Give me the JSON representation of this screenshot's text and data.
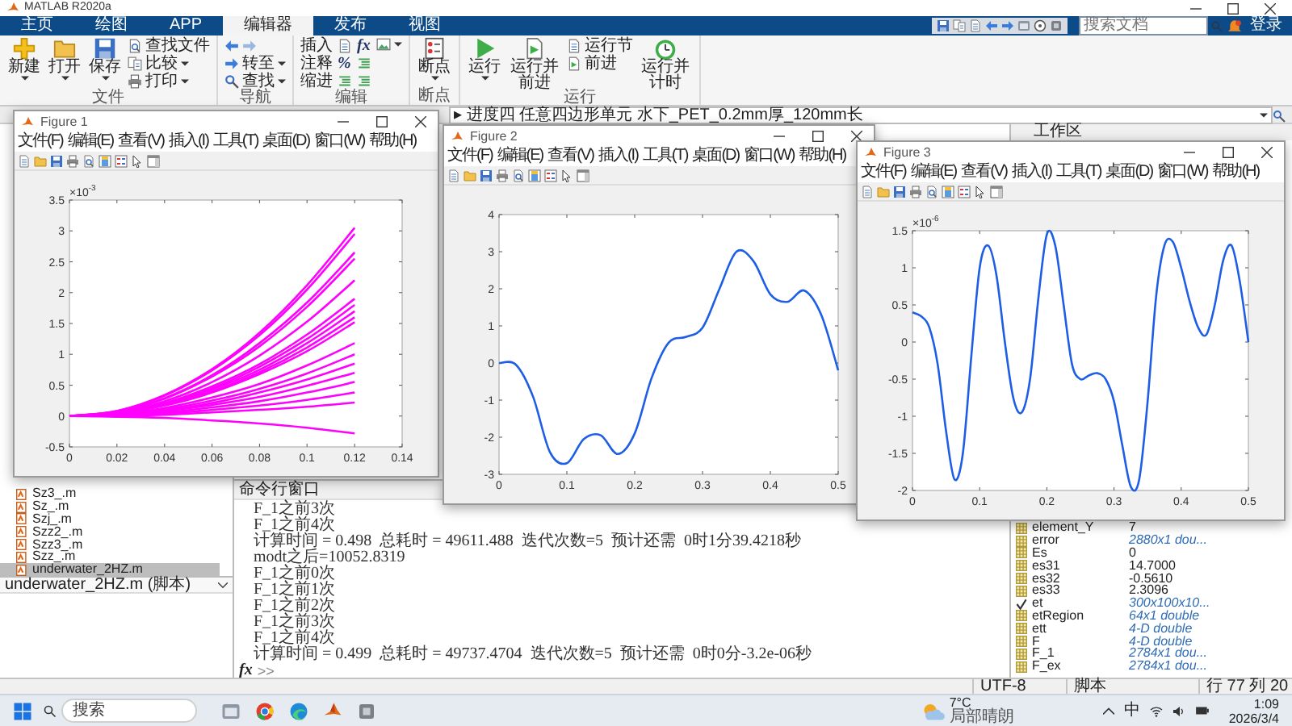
{
  "window": {
    "title": "MATLAB R2020a"
  },
  "tabs": [
    {
      "label": "主页",
      "selected": false
    },
    {
      "label": "绘图",
      "selected": false
    },
    {
      "label": "APP",
      "selected": false
    },
    {
      "label": "编辑器",
      "selected": true
    },
    {
      "label": "发布",
      "selected": false
    },
    {
      "label": "视图",
      "selected": false
    }
  ],
  "search": {
    "placeholder": "搜索文档"
  },
  "sign_in": "登录",
  "ribbon": [
    {
      "label": "文件",
      "columns": [
        [
          [
            {
              "kind": "large",
              "label": "新建",
              "dropdown": true
            }
          ]
        ],
        [
          [
            {
              "kind": "large",
              "label": "打开",
              "dropdown": true
            }
          ]
        ],
        [
          [
            {
              "kind": "large",
              "label": "保存",
              "dropdown": true
            }
          ]
        ],
        [
          [
            {
              "kind": "small",
              "label": "查找文件",
              "dropdown": false
            }
          ],
          [
            {
              "kind": "small",
              "label": "比较",
              "dropdown": true
            }
          ],
          [
            {
              "kind": "small",
              "label": "打印",
              "dropdown": true
            }
          ]
        ]
      ]
    },
    {
      "label": "导航",
      "columns": [
        [
          [
            {
              "kind": "icon",
              "dropdown": false
            },
            {
              "kind": "icon",
              "dropdown": false
            }
          ],
          [
            {
              "kind": "small",
              "label": "转至",
              "dropdown": true
            }
          ],
          [
            {
              "kind": "small",
              "label": "查找",
              "dropdown": true
            }
          ]
        ]
      ]
    },
    {
      "label": "编辑",
      "columns": [
        [
          [
            {
              "kind": "label",
              "label": "插入"
            }
          ],
          [
            {
              "kind": "label",
              "label": "注释"
            }
          ],
          [
            {
              "kind": "label",
              "label": "缩进"
            }
          ]
        ],
        [
          [
            {
              "kind": "icon",
              "dropdown": false
            }
          ],
          [
            {
              "kind": "glyph",
              "text": "%"
            }
          ],
          [
            {
              "kind": "icon",
              "dropdown": false
            }
          ]
        ],
        [
          [
            {
              "kind": "glyph",
              "text": "fx"
            }
          ],
          [
            {
              "kind": "icon",
              "dropdown": false
            }
          ],
          [
            {
              "kind": "icon",
              "dropdown": false
            }
          ]
        ],
        [
          [
            {
              "kind": "icon",
              "dropdown": true
            }
          ]
        ]
      ]
    },
    {
      "label": "断点",
      "columns": [
        [
          [
            {
              "kind": "large",
              "label": "断点",
              "dropdown": true
            }
          ]
        ]
      ]
    },
    {
      "label": "运行",
      "columns": [
        [
          [
            {
              "kind": "large",
              "label": "运行",
              "dropdown": true
            }
          ]
        ],
        [
          [
            {
              "kind": "large",
              "label": "运行并前进",
              "dropdown": false
            }
          ]
        ],
        [
          [
            {
              "kind": "small",
              "label": "运行节",
              "dropdown": false
            }
          ],
          [
            {
              "kind": "small",
              "label": "前进",
              "dropdown": false
            }
          ]
        ],
        [
          [
            {
              "kind": "large",
              "label": "运行并计时",
              "dropdown": false
            }
          ]
        ]
      ]
    }
  ],
  "address": "▸ 进度四 任意四边形单元 水下_PET_0.2mm厚_120mm长",
  "file_browser": {
    "items": [
      {
        "name": "Sz3_.m",
        "selected": false
      },
      {
        "name": "Sz_.m",
        "selected": false
      },
      {
        "name": "Szj_.m",
        "selected": false
      },
      {
        "name": "Szz2_.m",
        "selected": false
      },
      {
        "name": "Szz3_.m",
        "selected": false
      },
      {
        "name": "Szz_.m",
        "selected": false
      },
      {
        "name": "underwater_2HZ.m",
        "selected": true
      }
    ],
    "details": "underwater_2HZ.m (脚本)"
  },
  "command_window": {
    "title": "命令行窗口",
    "lines": [
      "F_1之前3次",
      "F_1之前4次",
      "计算时间 = 0.498  总耗时 = 49611.488  迭代次数=5  预计还需  0时1分39.4218秒",
      "modt之后=10052.8319",
      "F_1之前0次",
      "F_1之前1次",
      "F_1之前2次",
      "F_1之前3次",
      "F_1之前4次",
      "计算时间 = 0.499  总耗时 = 49737.4704  迭代次数=5  预计还需  0时0分-3.2e-06秒"
    ],
    "prompt": {
      "glyph": "fx",
      "text": ">>"
    }
  },
  "workspace": {
    "title": "工作区",
    "variables": [
      {
        "name": "element_Y",
        "value": "7",
        "kind": "scalar"
      },
      {
        "name": "error",
        "value": "2880x1 dou...",
        "kind": "array"
      },
      {
        "name": "Es",
        "value": "0",
        "kind": "scalar"
      },
      {
        "name": "es31",
        "value": "14.7000",
        "kind": "scalar"
      },
      {
        "name": "es32",
        "value": "-0.5610",
        "kind": "scalar"
      },
      {
        "name": "es33",
        "value": "2.3096",
        "kind": "scalar"
      },
      {
        "name": "et",
        "value": "300x100x10...",
        "kind": "logical"
      },
      {
        "name": "etRegion",
        "value": "64x1 double",
        "kind": "array"
      },
      {
        "name": "ett",
        "value": "4-D double",
        "kind": "array"
      },
      {
        "name": "F",
        "value": "4-D double",
        "kind": "array"
      },
      {
        "name": "F_1",
        "value": "2784x1 dou...",
        "kind": "array"
      },
      {
        "name": "F_ex",
        "value": "2784x1 dou...",
        "kind": "array"
      }
    ]
  },
  "status_bar": {
    "encoding": "UTF-8",
    "file_type": "脚本",
    "cursor": "行 77 列 20"
  },
  "figures": [
    {
      "title": "Figure 1",
      "menu": [
        "文件(F)",
        "编辑(E)",
        "查看(V)",
        "插入(I)",
        "工具(T)",
        "桌面(D)",
        "窗口(W)",
        "帮助(H)"
      ],
      "axis_exponent": "×10$^{-3}$",
      "chart_data": {
        "type": "line",
        "x": [
          0,
          0.02,
          0.04,
          0.06,
          0.08,
          0.1,
          0.12
        ],
        "xlim": [
          0,
          0.14
        ],
        "ylim": [
          -0.5,
          3.5
        ],
        "xticks": [
          0,
          0.02,
          0.04,
          0.06,
          0.08,
          0.1,
          0.12,
          0.14
        ],
        "yticks": [
          -0.5,
          0,
          0.5,
          1,
          1.5,
          2,
          2.5,
          3,
          3.5
        ],
        "series": [
          {
            "color": "#ff00ff",
            "values": [
              0,
              0.08,
              0.34,
              0.76,
              1.35,
              2.12,
              3.05
            ]
          },
          {
            "color": "#ff00ff",
            "values": [
              0,
              0.08,
              0.33,
              0.74,
              1.31,
              2.05,
              2.95
            ]
          },
          {
            "color": "#ff00ff",
            "values": [
              0,
              0.07,
              0.29,
              0.66,
              1.18,
              1.84,
              2.65
            ]
          },
          {
            "color": "#ff00ff",
            "values": [
              0,
              0.07,
              0.28,
              0.64,
              1.13,
              1.77,
              2.55
            ]
          },
          {
            "color": "#ff00ff",
            "values": [
              0,
              0.06,
              0.24,
              0.55,
              0.98,
              1.53,
              2.2
            ]
          },
          {
            "color": "#ff00ff",
            "values": [
              0,
              0.05,
              0.21,
              0.48,
              0.84,
              1.32,
              1.9
            ]
          },
          {
            "color": "#ff00ff",
            "values": [
              0,
              0.05,
              0.2,
              0.45,
              0.8,
              1.25,
              1.8
            ]
          },
          {
            "color": "#ff00ff",
            "values": [
              0,
              0.05,
              0.19,
              0.43,
              0.75,
              1.18,
              1.7
            ]
          },
          {
            "color": "#ff00ff",
            "values": [
              0,
              0.04,
              0.18,
              0.4,
              0.71,
              1.11,
              1.6
            ]
          },
          {
            "color": "#ff00ff",
            "values": [
              0,
              0.04,
              0.17,
              0.38,
              0.68,
              1.05,
              1.52
            ]
          },
          {
            "color": "#ff00ff",
            "values": [
              0,
              0.03,
              0.13,
              0.3,
              0.52,
              0.82,
              1.18
            ]
          },
          {
            "color": "#ff00ff",
            "values": [
              0,
              0.03,
              0.11,
              0.25,
              0.44,
              0.69,
              1
            ]
          },
          {
            "color": "#ff00ff",
            "values": [
              0,
              0.02,
              0.09,
              0.21,
              0.38,
              0.59,
              0.85
            ]
          },
          {
            "color": "#ff00ff",
            "values": [
              0,
              0.02,
              0.08,
              0.18,
              0.31,
              0.49,
              0.7
            ]
          },
          {
            "color": "#ff00ff",
            "values": [
              0,
              0.02,
              0.06,
              0.14,
              0.24,
              0.38,
              0.55
            ]
          },
          {
            "color": "#ff00ff",
            "values": [
              0,
              0.01,
              0.04,
              0.1,
              0.17,
              0.26,
              0.38
            ]
          },
          {
            "color": "#ff00ff",
            "values": [
              0,
              0.01,
              0.02,
              0.06,
              0.1,
              0.15,
              0.22
            ]
          },
          {
            "color": "#ff00ff",
            "values": [
              0,
              -0.01,
              -0.03,
              -0.07,
              -0.12,
              -0.19,
              -0.28
            ]
          }
        ]
      }
    },
    {
      "title": "Figure 2",
      "menu": [
        "文件(F)",
        "编辑(E)",
        "查看(V)",
        "插入(I)",
        "工具(T)",
        "桌面(D)",
        "窗口(W)",
        "帮助(H)"
      ],
      "chart_data": {
        "type": "line",
        "x": [
          0,
          0.025,
          0.05,
          0.075,
          0.1,
          0.125,
          0.15,
          0.175,
          0.2,
          0.225,
          0.25,
          0.275,
          0.3,
          0.325,
          0.35,
          0.375,
          0.4,
          0.425,
          0.45,
          0.475,
          0.5
        ],
        "xlim": [
          0,
          0.5
        ],
        "ylim": [
          -3,
          4
        ],
        "xticks": [
          0,
          0.1,
          0.2,
          0.3,
          0.4,
          0.5
        ],
        "yticks": [
          -3,
          -2,
          -1,
          0,
          1,
          2,
          3,
          4
        ],
        "series": [
          {
            "color": "#1e5ee6",
            "values": [
              0,
              -0.05,
              -0.9,
              -2.4,
              -2.7,
              -2.05,
              -1.95,
              -2.45,
              -1.9,
              -0.4,
              0.55,
              0.7,
              0.95,
              2,
              3,
              2.75,
              1.85,
              1.65,
              1.95,
              1.3,
              -0.2
            ]
          }
        ]
      }
    },
    {
      "title": "Figure 3",
      "menu": [
        "文件(F)",
        "编辑(E)",
        "查看(V)",
        "插入(I)",
        "工具(T)",
        "桌面(D)",
        "窗口(W)",
        "帮助(H)"
      ],
      "axis_exponent": "×10$^{-6}$",
      "chart_data": {
        "type": "line",
        "x": [
          0,
          0.0125,
          0.025,
          0.0375,
          0.05,
          0.0625,
          0.075,
          0.0875,
          0.1,
          0.1125,
          0.125,
          0.1375,
          0.15,
          0.1625,
          0.175,
          0.1875,
          0.2,
          0.2125,
          0.225,
          0.2375,
          0.25,
          0.2625,
          0.275,
          0.2875,
          0.3,
          0.3125,
          0.325,
          0.3375,
          0.35,
          0.3625,
          0.375,
          0.3875,
          0.4,
          0.4125,
          0.425,
          0.4375,
          0.45,
          0.4625,
          0.475,
          0.4875,
          0.5
        ],
        "xlim": [
          0,
          0.5
        ],
        "ylim": [
          -2,
          1.5
        ],
        "xticks": [
          0,
          0.1,
          0.2,
          0.3,
          0.4,
          0.5
        ],
        "yticks": [
          -2,
          -1.5,
          -1,
          -0.5,
          0,
          0.5,
          1,
          1.5
        ],
        "series": [
          {
            "color": "#1e5ee6",
            "values": [
              0.4,
              0.35,
              0.2,
              -0.3,
              -1.2,
              -1.85,
              -1.5,
              -0.2,
              1,
              1.3,
              0.9,
              0,
              -0.75,
              -0.95,
              -0.5,
              0.6,
              1.45,
              1.3,
              0.5,
              -0.3,
              -0.5,
              -0.45,
              -0.42,
              -0.5,
              -0.8,
              -1.4,
              -1.95,
              -1.85,
              -0.8,
              0.6,
              1.3,
              1.35,
              1,
              0.55,
              0.2,
              0.1,
              0.5,
              1.1,
              1.3,
              0.8,
              0
            ]
          }
        ]
      }
    }
  ],
  "taskbar": {
    "search_placeholder": "搜索",
    "weather": {
      "temperature": "7°C",
      "condition": "局部晴朗"
    },
    "input_method": "中",
    "time": "1:09",
    "date": "2026/3/4"
  }
}
